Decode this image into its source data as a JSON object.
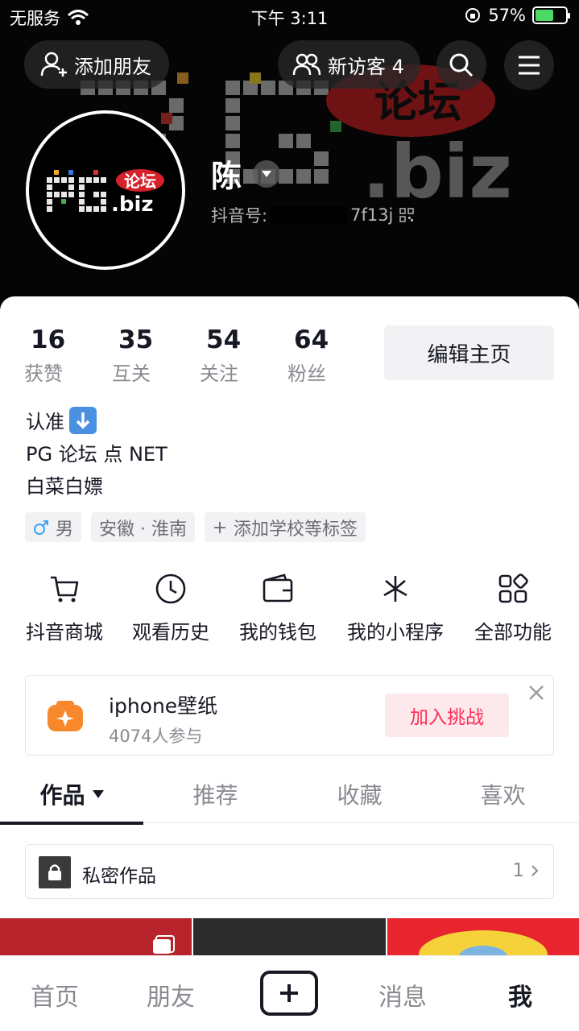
{
  "status_bar": {
    "carrier": "无服务",
    "time": "下午 3:11",
    "battery": "57%"
  },
  "header": {
    "add_friend": "添加朋友",
    "visitors": "新访客 4"
  },
  "profile": {
    "username": "陈",
    "id_label": "抖音号:",
    "id_suffix": "7f13j",
    "avatar_logo": "PG",
    "avatar_logo_tag": "论坛",
    "avatar_logo_domain": ".biz"
  },
  "stats": [
    {
      "value": "16",
      "label": "获赞"
    },
    {
      "value": "35",
      "label": "互关"
    },
    {
      "value": "54",
      "label": "关注"
    },
    {
      "value": "64",
      "label": "粉丝"
    }
  ],
  "edit_profile": "编辑主页",
  "bio": {
    "line1": "认准",
    "line2": "PG 论坛 点 NET",
    "line3": "白菜白嫖"
  },
  "tags": {
    "gender": "男",
    "location": "安徽 · 淮南",
    "add": "添加学校等标签"
  },
  "features": [
    {
      "label": "抖音商城",
      "icon": "cart-icon"
    },
    {
      "label": "观看历史",
      "icon": "clock-icon"
    },
    {
      "label": "我的钱包",
      "icon": "wallet-icon"
    },
    {
      "label": "我的小程序",
      "icon": "asterisk-icon"
    },
    {
      "label": "全部功能",
      "icon": "grid-icon"
    }
  ],
  "challenge": {
    "title": "iphone壁纸",
    "subtitle": "4074人参与",
    "join": "加入挑战"
  },
  "tabs": [
    "作品",
    "推荐",
    "收藏",
    "喜欢"
  ],
  "private_works": {
    "title": "私密作品",
    "count": "1"
  },
  "bottom_nav": {
    "home": "首页",
    "friends": "朋友",
    "messages": "消息",
    "me": "我"
  },
  "colors": {
    "accent": "#fe2c55",
    "challenge_icon": "#f7892c",
    "battery_fill": "#4cd964"
  }
}
